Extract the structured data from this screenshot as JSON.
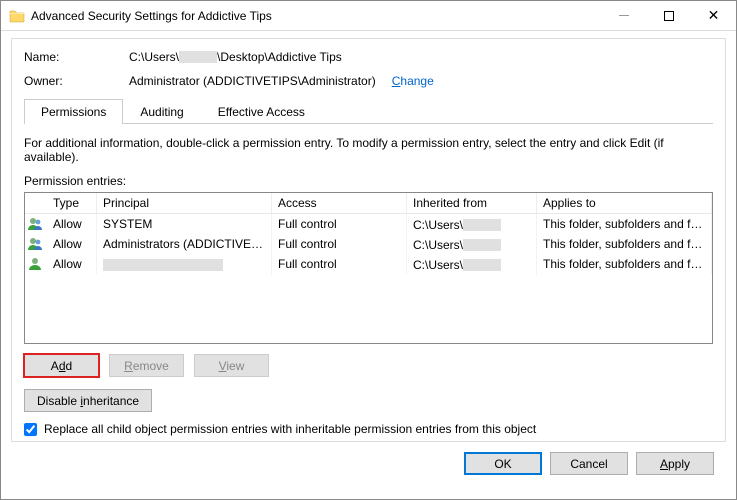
{
  "window": {
    "title": "Advanced Security Settings for Addictive Tips"
  },
  "fields": {
    "name_label": "Name:",
    "name_value_prefix": "C:\\Users\\",
    "name_value_suffix": "\\Desktop\\Addictive Tips",
    "owner_label": "Owner:",
    "owner_value": "Administrator (ADDICTIVETIPS\\Administrator)",
    "change_label": "Change"
  },
  "tabs": [
    {
      "label": "Permissions",
      "active": true
    },
    {
      "label": "Auditing",
      "active": false
    },
    {
      "label": "Effective Access",
      "active": false
    }
  ],
  "info_text": "For additional information, double-click a permission entry. To modify a permission entry, select the entry and click Edit (if available).",
  "entries_label": "Permission entries:",
  "columns": {
    "type": "Type",
    "principal": "Principal",
    "access": "Access",
    "inherited": "Inherited from",
    "applies": "Applies to"
  },
  "rows": [
    {
      "type": "Allow",
      "principal": "SYSTEM",
      "access": "Full control",
      "inherited_prefix": "C:\\Users\\",
      "applies": "This folder, subfolders and files"
    },
    {
      "type": "Allow",
      "principal": "Administrators (ADDICTIVETIP...",
      "access": "Full control",
      "inherited_prefix": "C:\\Users\\",
      "applies": "This folder, subfolders and files"
    },
    {
      "type": "Allow",
      "principal": "",
      "access": "Full control",
      "inherited_prefix": "C:\\Users\\",
      "applies": "This folder, subfolders and files"
    }
  ],
  "buttons": {
    "add": "Add",
    "remove": "Remove",
    "view": "View",
    "disable_inheritance": "Disable inheritance",
    "ok": "OK",
    "cancel": "Cancel",
    "apply": "Apply"
  },
  "checkbox": {
    "label": "Replace all child object permission entries with inheritable permission entries from this object",
    "checked": true
  }
}
